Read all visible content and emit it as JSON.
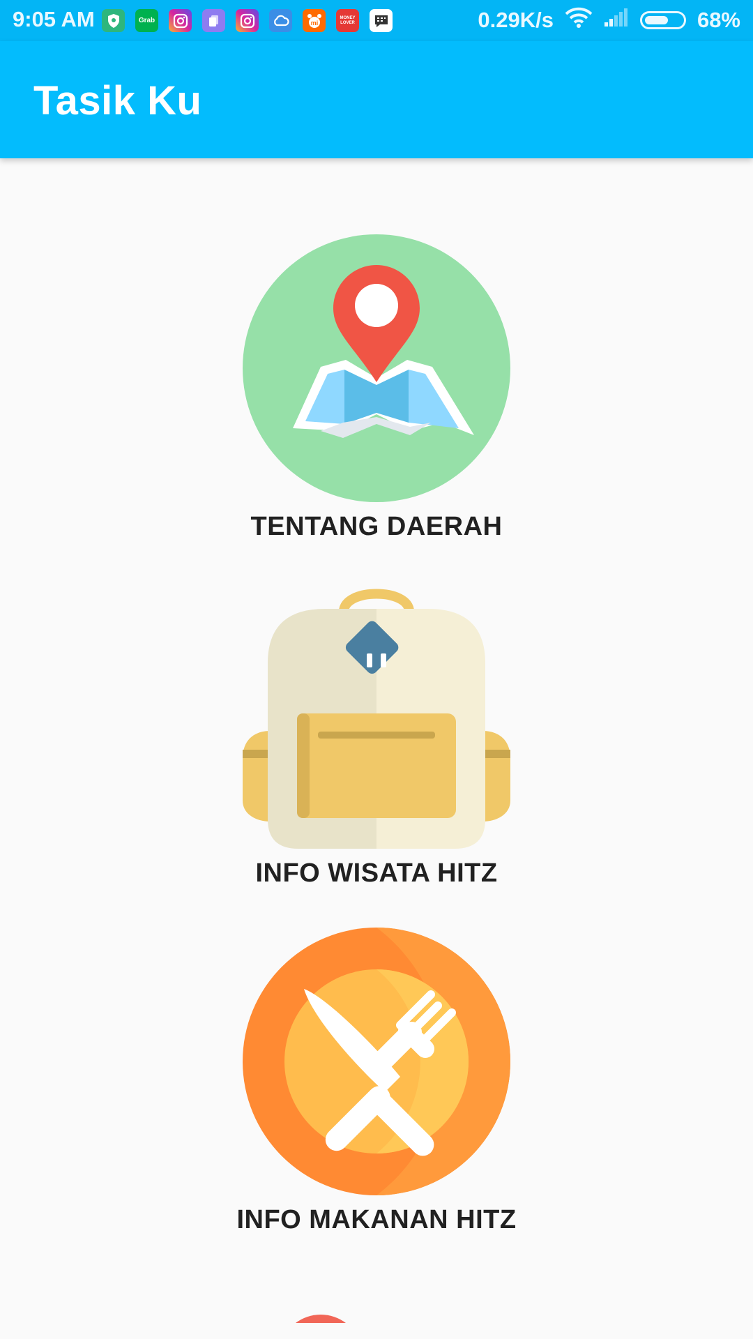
{
  "status_bar": {
    "time": "9:05 AM",
    "network_speed": "0.29K/s",
    "battery_percent": "68%",
    "battery_level": 0.68,
    "notifications": [
      {
        "name": "shield-icon",
        "color": "#2eb67d"
      },
      {
        "name": "grab-icon",
        "label": "Grab",
        "color": "#00b14f"
      },
      {
        "name": "instagram-icon",
        "color": "#d6249f"
      },
      {
        "name": "files-icon",
        "color": "#8e7cf0"
      },
      {
        "name": "instagram-icon",
        "color": "#d6249f"
      },
      {
        "name": "cloud-icon",
        "color": "#3a8ee6"
      },
      {
        "name": "mi-icon",
        "color": "#ff6a00"
      },
      {
        "name": "money-lover-icon",
        "label": "MONEY LOVER",
        "color": "#e53935"
      },
      {
        "name": "bbm-icon",
        "color": "#ffffff"
      }
    ]
  },
  "app_bar": {
    "title": "Tasik Ku",
    "color": "#03bcfd"
  },
  "menu": {
    "items": [
      {
        "label": "TENTANG DAERAH",
        "icon": "map-pin-icon",
        "icon_bg": "#96e0a8"
      },
      {
        "label": "INFO WISATA HITZ",
        "icon": "backpack-icon",
        "icon_bg": "#f5efd6"
      },
      {
        "label": "INFO MAKANAN HITZ",
        "icon": "cutlery-icon",
        "icon_bg": "#ff9233"
      }
    ]
  }
}
